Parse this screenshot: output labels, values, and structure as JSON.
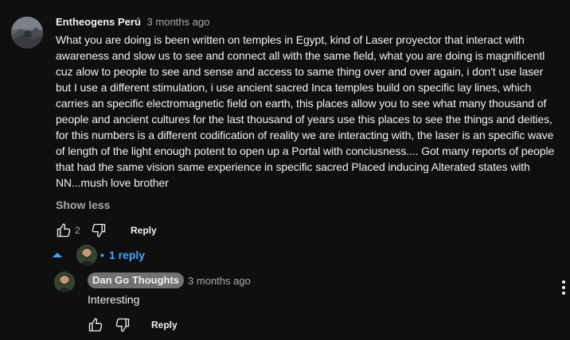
{
  "comment": {
    "author": "Entheogens Perú",
    "time": "3 months ago",
    "text": "What you are doing is been written on temples in Egypt, kind of Laser proyector that interact with awareness and slow us to see and connect all with the same field, what you are doing is magnificentl cuz alow to people to see and sense and access to same thing over and over again, i don't use laser but I use a different stimulation, i use ancient sacred Inca temples build on specific lay lines, which carries an specific electromagnetic field on earth, this places allow you to see what many thousand of people and ancient cultures  for the last thousand of years use this places to see the things and deities, for this numbers is a different codification of  reality we are interacting with, the laser is an specific wave of length of the light enough potent to open up a Portal with conciusness.... Got many reports of people that had the same vision same experience in specific sacred Placed inducing Alterated states with NN...mush love brother",
    "show_less": "Show less",
    "like_count": "2",
    "reply_label": "Reply",
    "avatar_icon": "user-avatar",
    "colors": {
      "background": "#0f0f0f",
      "text": "#f1f1f1",
      "secondary": "#aaaaaa",
      "link": "#3ea6ff"
    }
  },
  "replies": {
    "toggle_label": "1 reply",
    "toggle_icon": "caret-up-icon",
    "items": [
      {
        "author": "Dan Go Thoughts",
        "time": "3 months ago",
        "text": "Interesting",
        "reply_label": "Reply",
        "author_chip_color": "#717171"
      }
    ]
  },
  "icons": {
    "like": "thumbs-up-icon",
    "dislike": "thumbs-down-icon",
    "more": "more-vert-icon"
  }
}
